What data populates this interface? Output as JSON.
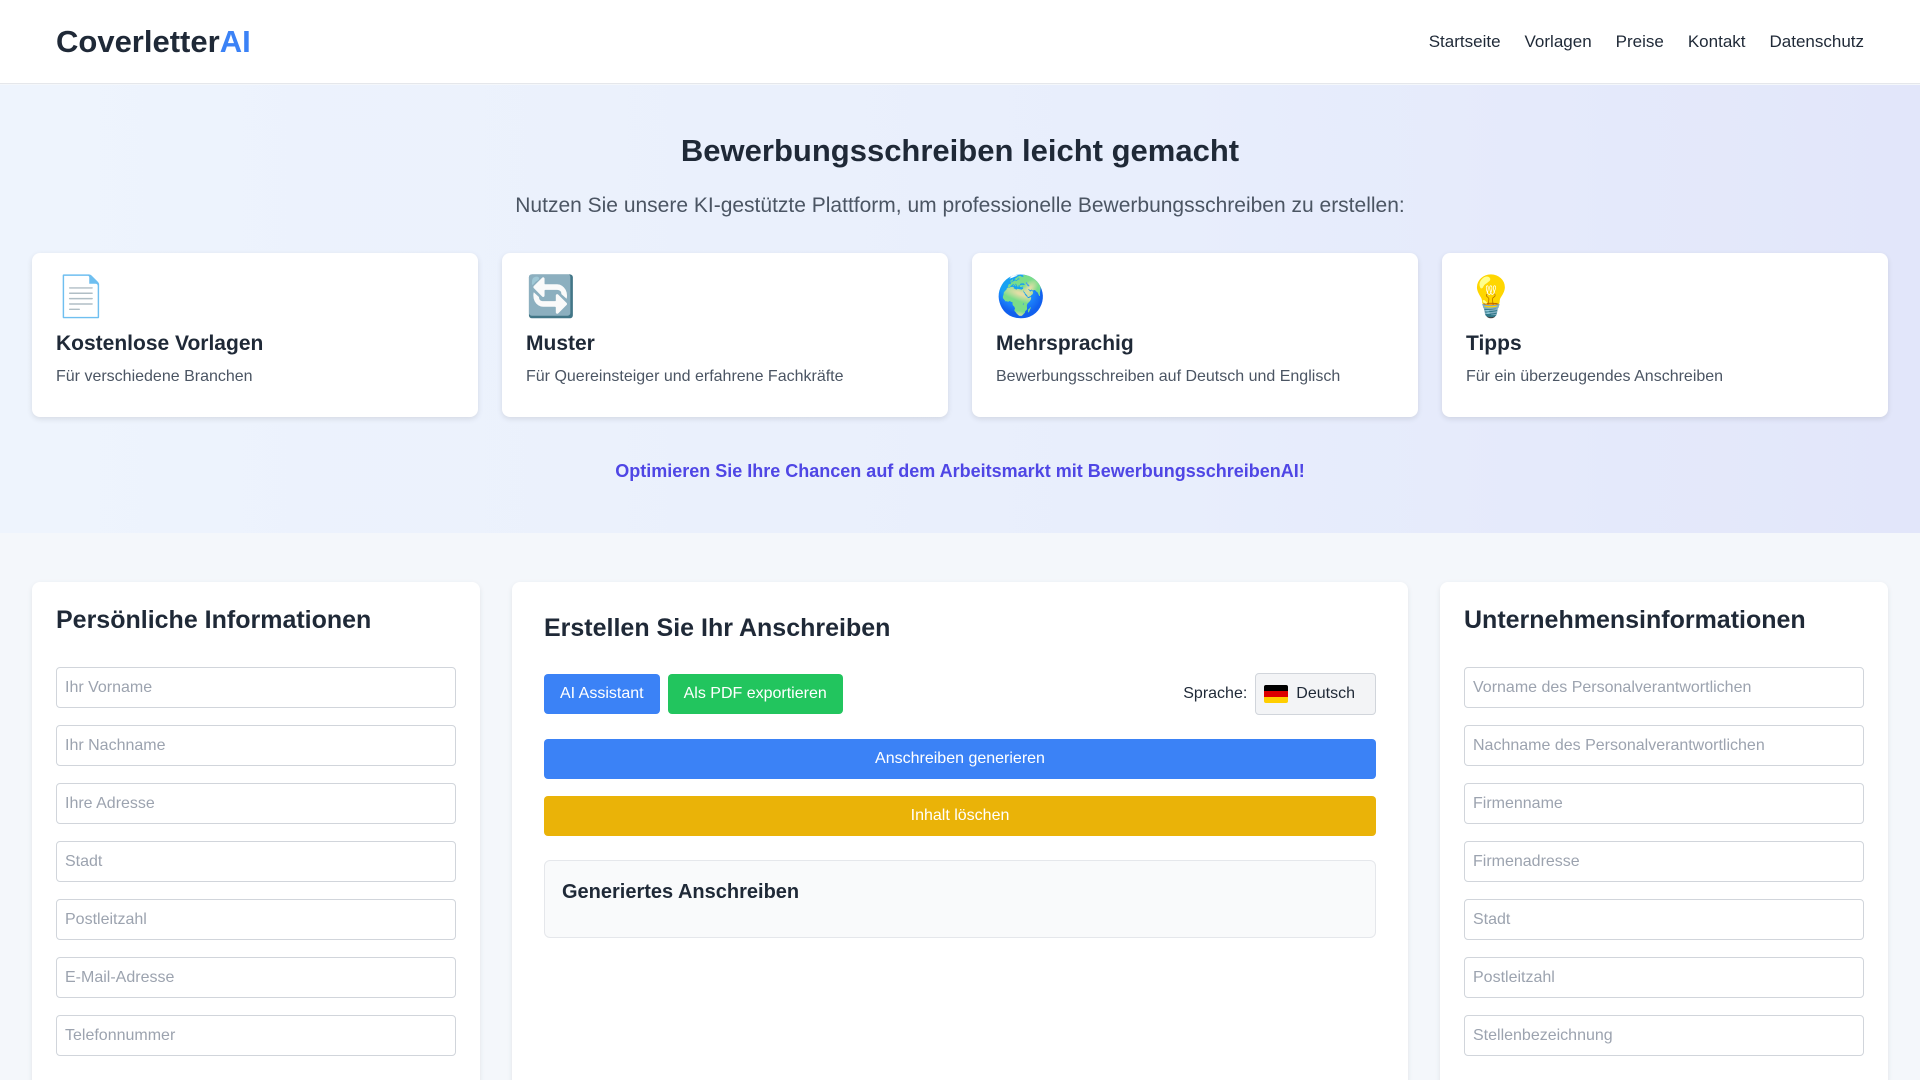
{
  "header": {
    "brand_main": "Coverletter",
    "brand_accent": "AI",
    "nav": [
      "Startseite",
      "Vorlagen",
      "Preise",
      "Kontakt",
      "Datenschutz"
    ]
  },
  "hero": {
    "title": "Bewerbungsschreiben leicht gemacht",
    "subtitle": "Nutzen Sie unsere KI-gestützte Plattform, um professionelle Bewerbungsschreiben zu erstellen:",
    "features": [
      {
        "icon": "📄",
        "icon_name": "document-icon",
        "title": "Kostenlose Vorlagen",
        "desc": "Für verschiedene Branchen"
      },
      {
        "icon": "🔄",
        "icon_name": "refresh-icon",
        "title": "Muster",
        "desc": "Für Quereinsteiger und erfahrene Fachkräfte"
      },
      {
        "icon": "🌍",
        "icon_name": "globe-icon",
        "title": "Mehrsprachig",
        "desc": "Bewerbungsschreiben auf Deutsch und Englisch"
      },
      {
        "icon": "💡",
        "icon_name": "lightbulb-icon",
        "title": "Tipps",
        "desc": "Für ein überzeugendes Anschreiben"
      }
    ],
    "cta": "Optimieren Sie Ihre Chancen auf dem Arbeitsmarkt mit BewerbungsschreibenAI!"
  },
  "personal": {
    "title": "Persönliche Informationen",
    "placeholders": [
      "Ihr Vorname",
      "Ihr Nachname",
      "Ihre Adresse",
      "Stadt",
      "Postleitzahl",
      "E-Mail-Adresse",
      "Telefonnummer"
    ]
  },
  "editor": {
    "title": "Erstellen Sie Ihr Anschreiben",
    "ai_button": "AI Assistant",
    "pdf_button": "Als PDF exportieren",
    "language_label": "Sprache:",
    "language_value": "Deutsch",
    "generate_button": "Anschreiben generieren",
    "clear_button": "Inhalt löschen",
    "output_title": "Generiertes Anschreiben"
  },
  "company": {
    "title": "Unternehmensinformationen",
    "placeholders": [
      "Vorname des Personalverantwortlichen",
      "Nachname des Personalverantwortlichen",
      "Firmenname",
      "Firmenadresse",
      "Stadt",
      "Postleitzahl",
      "Stellenbezeichnung"
    ]
  },
  "colors": {
    "accent": "#3b82f6",
    "green": "#22c55e",
    "yellow": "#eab308",
    "cta": "#4f46e5"
  }
}
